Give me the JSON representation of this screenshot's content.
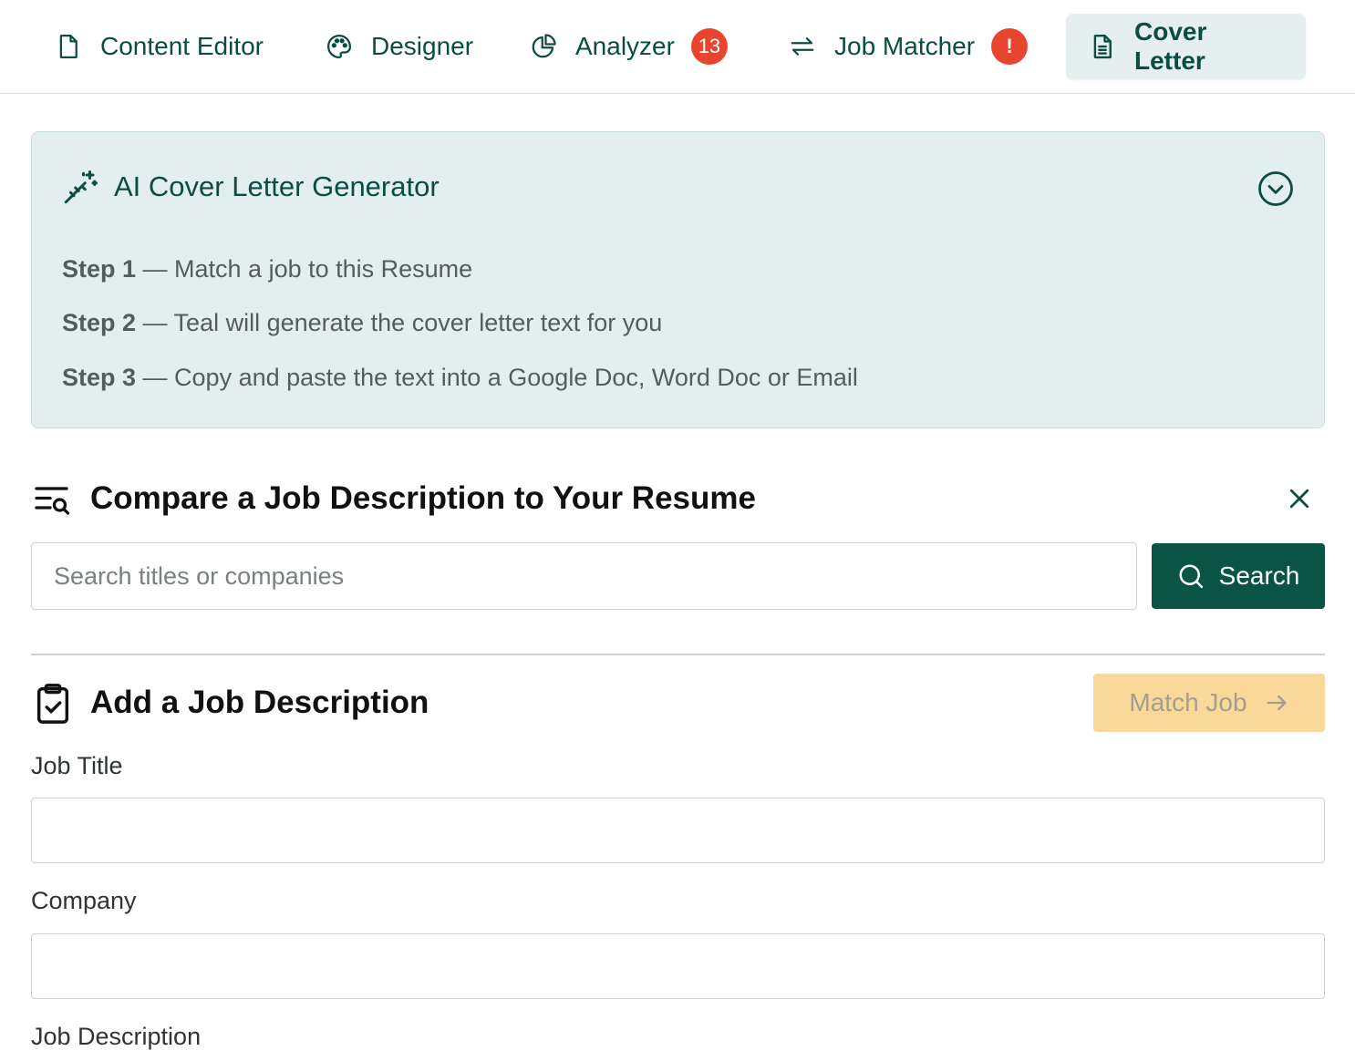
{
  "tabs": [
    {
      "label": "Content Editor",
      "icon": "document-icon"
    },
    {
      "label": "Designer",
      "icon": "palette-icon"
    },
    {
      "label": "Analyzer",
      "icon": "pie-chart-icon",
      "badge": "13"
    },
    {
      "label": "Job Matcher",
      "icon": "swap-arrows-icon",
      "badge": "!"
    },
    {
      "label": "Cover Letter",
      "icon": "document-lines-icon",
      "active": true
    }
  ],
  "generator": {
    "title": "AI Cover Letter Generator",
    "steps": [
      {
        "label": "Step 1",
        "text": " — Match a job to this Resume"
      },
      {
        "label": "Step 2",
        "text": " — Teal will generate the cover letter text for you"
      },
      {
        "label": "Step 3",
        "text": " — Copy and paste the text into a Google Doc, Word Doc or Email"
      }
    ]
  },
  "compare": {
    "title": "Compare a Job Description to Your Resume",
    "search_placeholder": "Search titles or companies",
    "search_value": "",
    "search_button": "Search"
  },
  "add_job": {
    "title": "Add a Job Description",
    "match_button": "Match Job",
    "fields": {
      "job_title": {
        "label": "Job Title",
        "value": ""
      },
      "company": {
        "label": "Company",
        "value": ""
      },
      "description": {
        "label": "Job Description"
      }
    }
  },
  "colors": {
    "brand": "#0a5446",
    "badge": "#e8452f",
    "card_bg": "#e2efee",
    "match_disabled": "#f8d99a"
  }
}
